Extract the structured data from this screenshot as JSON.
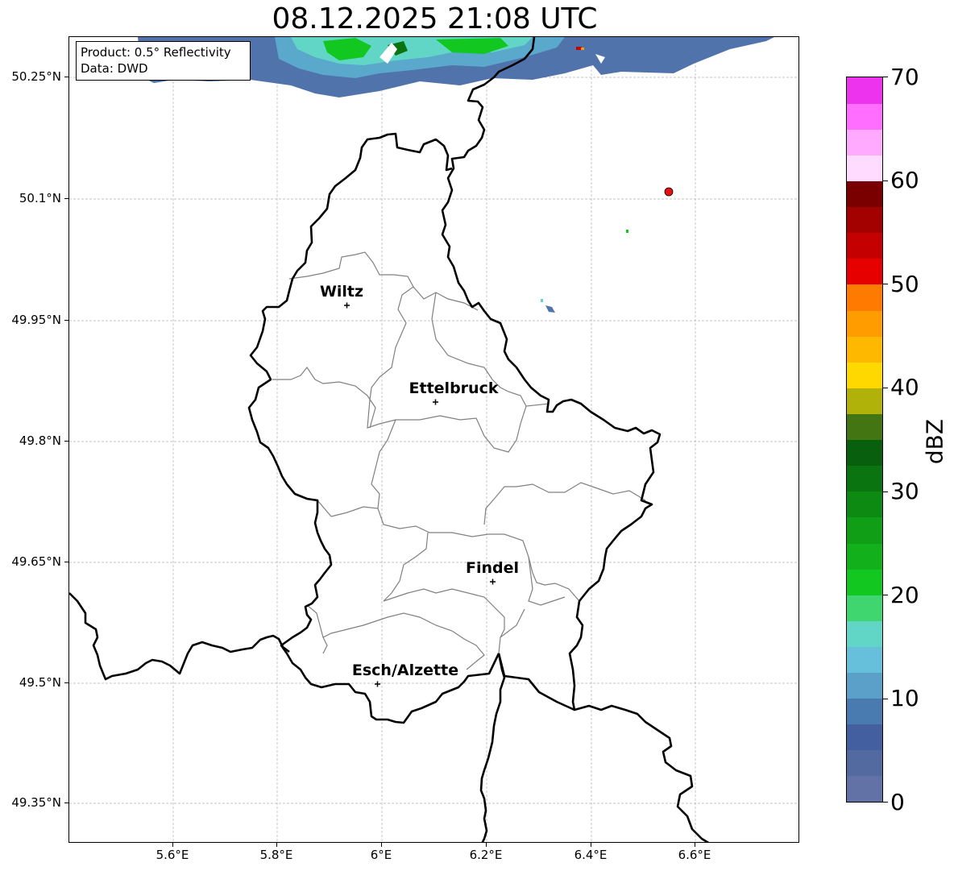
{
  "title": "08.12.2025 21:08 UTC",
  "info": {
    "product": "Product: 0.5° Reflectivity",
    "source": "Data: DWD"
  },
  "latitude_labels": [
    "50.25°N",
    "50.1°N",
    "49.95°N",
    "49.8°N",
    "49.65°N",
    "49.5°N",
    "49.35°N"
  ],
  "longitude_labels": [
    "5.6°E",
    "5.8°E",
    "6°E",
    "6.2°E",
    "6.4°E",
    "6.6°E"
  ],
  "cities": [
    {
      "name": "Wiltz"
    },
    {
      "name": "Ettelbruck"
    },
    {
      "name": "Findel"
    },
    {
      "name": "Esch/Alzette"
    }
  ],
  "colorbar": {
    "label": "dBZ",
    "ticks": [
      "0",
      "10",
      "20",
      "30",
      "40",
      "50",
      "60",
      "70"
    ],
    "colors": [
      "#6272a6",
      "#526aa0",
      "#435fa0",
      "#4a7bb0",
      "#5ba0c8",
      "#66c0dc",
      "#62d6c6",
      "#3fd670",
      "#12c820",
      "#12b01a",
      "#109e16",
      "#0d8a12",
      "#0a7510",
      "#08600e",
      "#437612",
      "#b0b20a",
      "#ffd800",
      "#ffb800",
      "#ff9c00",
      "#ff7a00",
      "#e60000",
      "#c40000",
      "#a30000",
      "#7a0000",
      "#ffdcff",
      "#ffaaff",
      "#ff6eff",
      "#ee33ee"
    ]
  },
  "marker_color": "#e81010"
}
